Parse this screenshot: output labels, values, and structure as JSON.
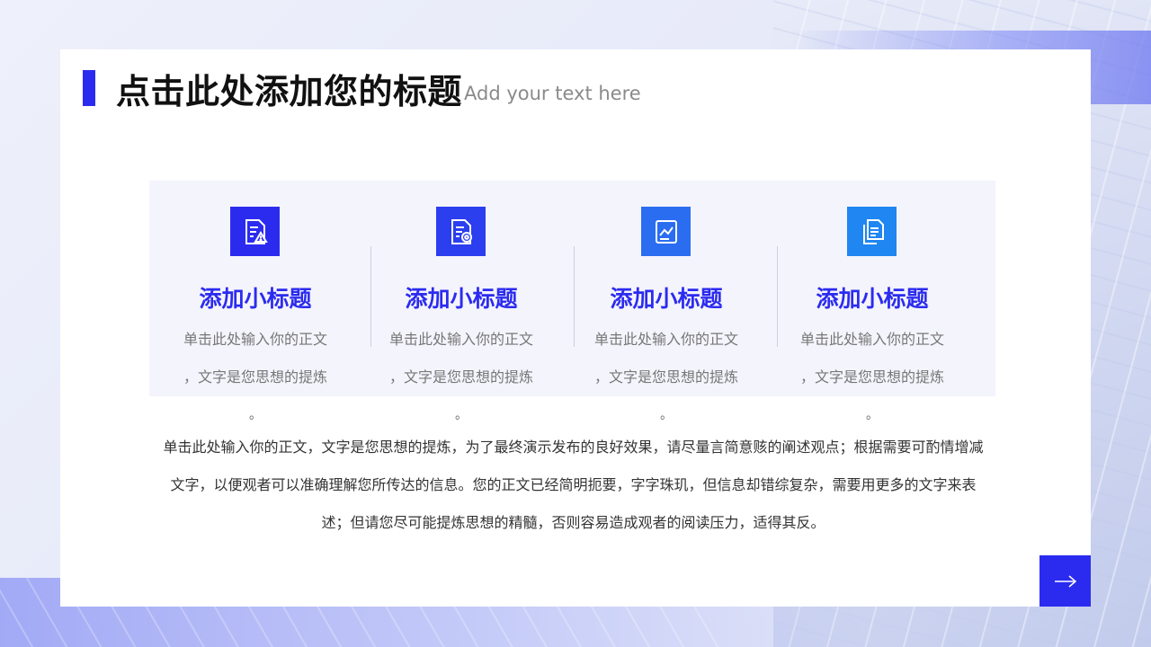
{
  "header": {
    "title": "点击此处添加您的标题",
    "subtitle": "Add your text here"
  },
  "columns": [
    {
      "icon": "document-warning-icon",
      "icon_color": "#2b2bf0",
      "title": "添加小标题",
      "line1": "单击此处输入你的正文",
      "line2": "，文字是您思想的提炼",
      "line3": "。"
    },
    {
      "icon": "document-settings-icon",
      "icon_color": "#2b3fee",
      "title": "添加小标题",
      "line1": "单击此处输入你的正文",
      "line2": "，文字是您思想的提炼",
      "line3": "。"
    },
    {
      "icon": "chart-document-icon",
      "icon_color": "#2a6df0",
      "title": "添加小标题",
      "line1": "单击此处输入你的正文",
      "line2": "，文字是您思想的提炼",
      "line3": "。"
    },
    {
      "icon": "copy-documents-icon",
      "icon_color": "#1f86f2",
      "title": "添加小标题",
      "line1": "单击此处输入你的正文",
      "line2": "，文字是您思想的提炼",
      "line3": "。"
    }
  ],
  "body": {
    "paragraph": "单击此处输入你的正文，文字是您思想的提炼，为了最终演示发布的良好效果，请尽量言简意赅的阐述观点；根据需要可酌情增减文字，以便观者可以准确理解您所传达的信息。您的正文已经简明扼要，字字珠玑，但信息却错综复杂，需要用更多的文字来表述；但请您尽可能提炼思想的精髓，否则容易造成观者的阅读压力，适得其反。"
  },
  "nav": {
    "next_icon": "arrow-right-icon"
  },
  "colors": {
    "accent": "#2b2bf0",
    "panel_bg": "#f4f4fd"
  }
}
